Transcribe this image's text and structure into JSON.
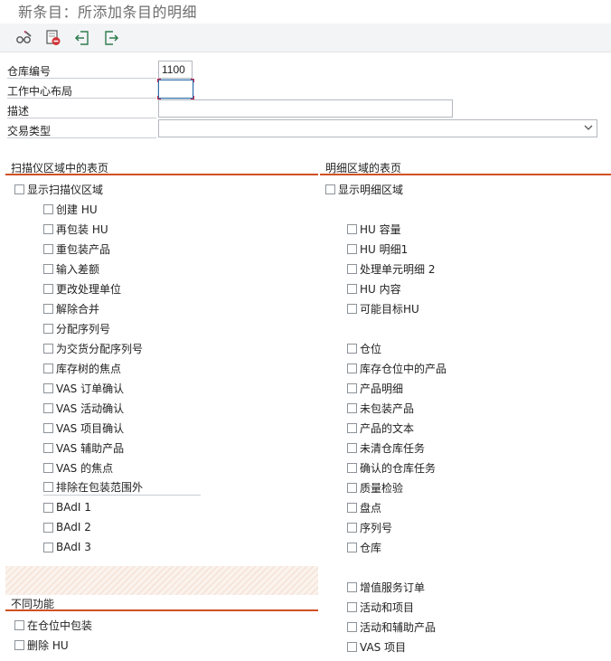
{
  "window": {
    "title": "新条目：所添加条目的明细"
  },
  "toolbar": {
    "buttons": [
      {
        "icon": "glasses-edit-icon"
      },
      {
        "icon": "delete-icon"
      },
      {
        "icon": "previous-entry-icon"
      },
      {
        "icon": "next-entry-icon"
      }
    ]
  },
  "form": {
    "warehouse_label": "仓库编号",
    "warehouse_value": "1100",
    "workcenter_label": "工作中心布局",
    "workcenter_value": "",
    "description_label": "描述",
    "description_value": "",
    "transaction_label": "交易类型",
    "transaction_value": ""
  },
  "scanner_panel": {
    "header": "扫描仪区域中的表页",
    "show_label": "显示扫描仪区域",
    "items": [
      "创建 HU",
      "再包装 HU",
      "重包装产品",
      "输入差额",
      "更改处理单位",
      "解除合并",
      "分配序列号",
      "为交货分配序列号",
      "库存树的焦点",
      "VAS 订单确认",
      "VAS 活动确认",
      "VAS 项目确认",
      "VAS 辅助产品",
      "VAS 的焦点",
      "排除在包装范围外",
      "BAdI 1",
      "BAdI 2",
      "BAdI 3"
    ]
  },
  "detail_panel": {
    "header": "明细区域的表页",
    "show_label": "显示明细区域",
    "group1": [
      "HU 容量",
      "HU 明细1",
      "处理单元明细 2",
      "HU 内容",
      "可能目标HU"
    ],
    "group2": [
      "仓位",
      "库存仓位中的产品",
      "产品明细",
      "未包装产品",
      "产品的文本",
      "未清仓库任务",
      "确认的仓库任务",
      "质量检验",
      "盘点",
      "序列号",
      "仓库"
    ],
    "group3": [
      "增值服务订单",
      "活动和项目",
      "活动和辅助产品",
      "VAS 项目"
    ]
  },
  "functions_panel": {
    "header": "不同功能",
    "items": [
      "在仓位中包装",
      "删除 HU"
    ]
  },
  "colors": {
    "accent": "#d05123",
    "focus_border": "#2d6da8",
    "focus_corner": "#c8264b"
  }
}
